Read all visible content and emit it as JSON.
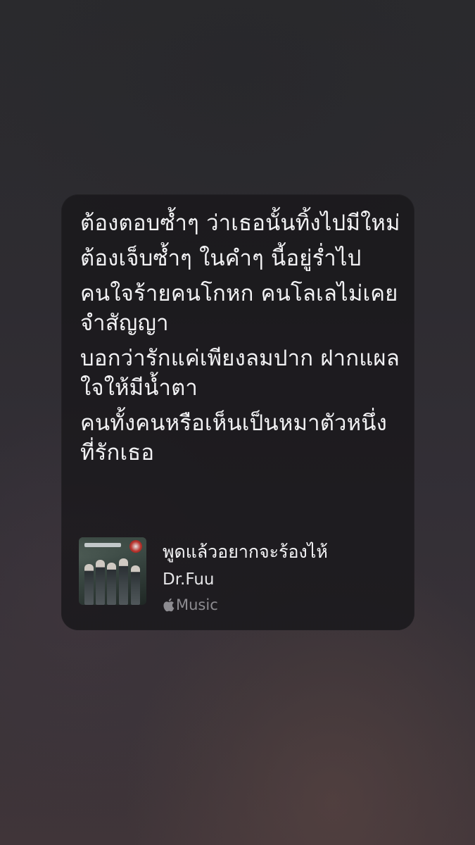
{
  "lyrics": [
    "ต้องตอบซ้ำๆ ว่าเธอนั้นทิ้งไปมีใหม่",
    "ต้องเจ็บซ้ำๆ ในคำๆ นี้อยู่ร่ำไป",
    "คนใจร้ายคนโกหก คนโลเลไม่เคยจำสัญญา",
    "บอกว่ารักแค่เพียงลมปาก ฝากแผลใจให้มีน้ำตา",
    "คนทั้งคนหรือเห็นเป็นหมาตัวหนึ่งที่รักเธอ"
  ],
  "track": {
    "title": "พูดแล้วอยากจะร้องไห้",
    "artist": "Dr.Fuu",
    "service_icon": "apple-icon",
    "service_label": "Music"
  },
  "colors": {
    "card_background": "#161518",
    "lyric_text": "#f2f2f4",
    "secondary_text": "#8d8c91"
  }
}
